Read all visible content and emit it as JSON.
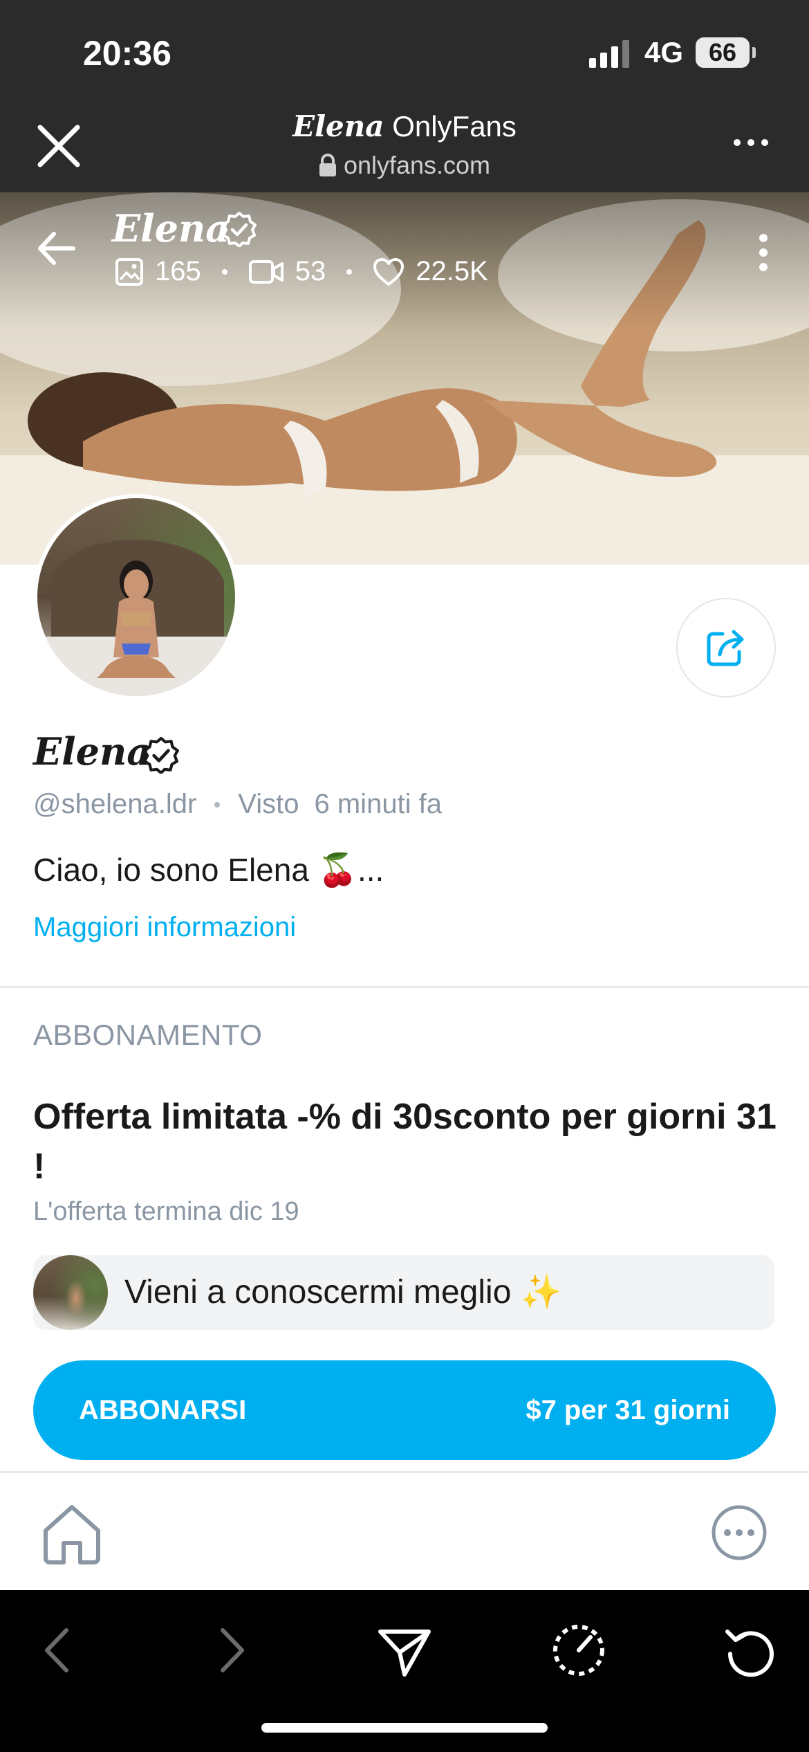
{
  "status_bar": {
    "time": "20:36",
    "network": "4G",
    "battery": "66"
  },
  "browser": {
    "title_name": "Elena",
    "title_brand": "OnlyFans",
    "url": "onlyfans.com"
  },
  "cover": {
    "name": "Elena",
    "stats": {
      "photos": "165",
      "videos": "53",
      "likes": "22.5K"
    }
  },
  "profile": {
    "name": "Elena",
    "handle": "@shelena.ldr",
    "last_seen_label": "Visto",
    "last_seen_value": "6 minuti fa",
    "bio": "Ciao, io sono Elena 🍒...",
    "more_info": "Maggiori informazioni"
  },
  "subscription": {
    "heading": "ABBONAMENTO",
    "offer_title": "Offerta limitata -% di 30sconto per giorni 31 !",
    "offer_ends": "L'offerta termina dic 19",
    "promo_message": "Vieni a conoscermi meglio ✨",
    "button_label": "ABBONARSI",
    "button_price": "$7 per 31 giorni"
  },
  "colors": {
    "accent": "#00aff0",
    "header_bg": "#2b2b2b",
    "muted_text": "#8a96a3"
  },
  "icons": {
    "close": "close-icon",
    "lock": "lock-icon",
    "more_horizontal": "more-horizontal-icon",
    "back": "arrow-left-icon",
    "verified": "verified-badge-icon",
    "photo": "image-icon",
    "video": "video-icon",
    "heart": "heart-icon",
    "more_vertical": "more-vertical-icon",
    "share": "share-icon",
    "home": "home-icon",
    "more_circle": "more-circle-icon"
  }
}
